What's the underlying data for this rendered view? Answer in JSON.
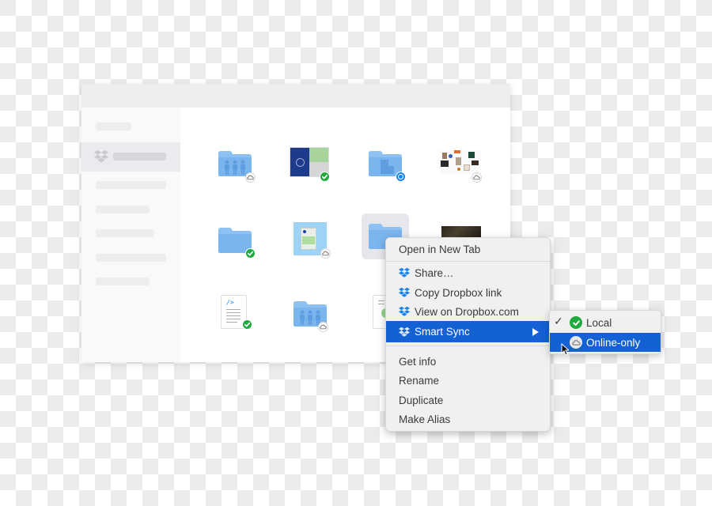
{
  "window": {
    "sidebar": {
      "active_item_icon": "dropbox-icon",
      "placeholder_item_count": 7
    },
    "files": [
      {
        "type": "folder",
        "glyph": "people",
        "status": "online-only"
      },
      {
        "type": "image",
        "thumb": "book-cover",
        "status": "local"
      },
      {
        "type": "folder",
        "glyph": "building",
        "status": "syncing"
      },
      {
        "type": "image",
        "thumb": "collage",
        "status": "online-only"
      },
      {
        "type": "folder",
        "glyph": "none",
        "status": "local"
      },
      {
        "type": "image",
        "thumb": "product-box",
        "status": "online-only"
      },
      {
        "type": "folder",
        "glyph": "none",
        "status": "selected"
      },
      {
        "type": "image",
        "thumb": "dark-photo",
        "status": ""
      },
      {
        "type": "document",
        "glyph": "code",
        "status": "local"
      },
      {
        "type": "folder",
        "glyph": "people",
        "status": "online-only"
      },
      {
        "type": "document",
        "glyph": "chart",
        "status": ""
      }
    ]
  },
  "context_menu": {
    "items": [
      {
        "label": "Open in New Tab"
      },
      {
        "label": "Share…",
        "icon": "dropbox-icon"
      },
      {
        "label": "Copy Dropbox link",
        "icon": "dropbox-icon"
      },
      {
        "label": "View on Dropbox.com",
        "icon": "dropbox-icon"
      },
      {
        "label": "Smart Sync",
        "icon": "dropbox-icon",
        "highlighted": true,
        "has_submenu": true
      },
      {
        "label": "Get info"
      },
      {
        "label": "Rename"
      },
      {
        "label": "Duplicate"
      },
      {
        "label": "Make Alias"
      }
    ]
  },
  "submenu": {
    "items": [
      {
        "label": "Local",
        "checked": true,
        "icon": "green-check-icon"
      },
      {
        "label": "Online-only",
        "checked": false,
        "icon": "cloud-icon",
        "highlighted": true
      }
    ]
  },
  "colors": {
    "highlight": "#1461d4",
    "folder": "#7fb8f0",
    "local_badge": "#1eaa3c",
    "sync_badge": "#1a82e8"
  }
}
